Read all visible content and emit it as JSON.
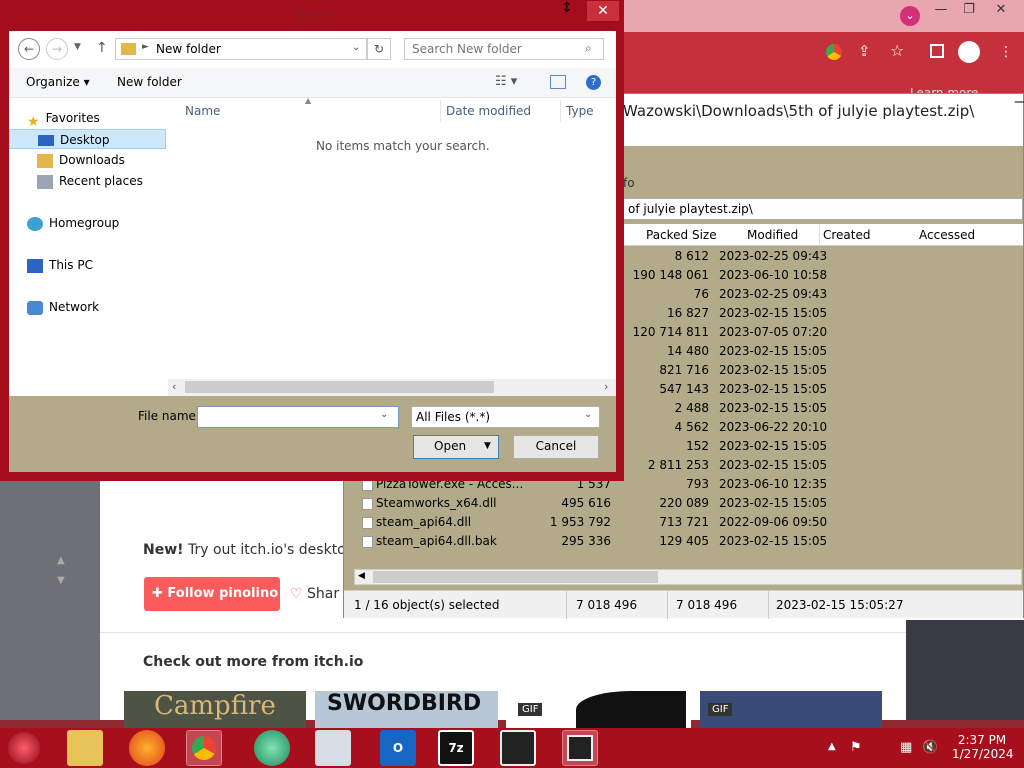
{
  "dialog": {
    "title": "Open",
    "close_glyph": "✕",
    "path_segment": "New folder",
    "search_placeholder": "Search New folder",
    "organize_label": "Organize ▾",
    "new_folder_label": "New folder",
    "columns": {
      "name": "Name",
      "date": "Date modified",
      "type": "Type"
    },
    "empty_message": "No items match your search.",
    "nav": {
      "favorites": "Favorites",
      "desktop": "Desktop",
      "downloads": "Downloads",
      "recent": "Recent places",
      "homegroup": "Homegroup",
      "thispc": "This PC",
      "network": "Network"
    },
    "filename_label": "File name:",
    "filename_value": "",
    "filetype_value": "All Files (*.*)",
    "open_label": "Open",
    "cancel_label": "Cancel"
  },
  "sevenzip": {
    "path_title": "Wazowski\\Downloads\\5th of julyie playtest.zip\\",
    "addr_path": "of julyie playtest.zip\\",
    "info_line": "fo",
    "columns": {
      "packed": "Packed Size",
      "modified": "Modified",
      "created": "Created",
      "accessed": "Accessed"
    },
    "rows": [
      {
        "name": "",
        "size": "",
        "packed": "8 612",
        "modified": "2023-02-25 09:43"
      },
      {
        "name": "",
        "size": "",
        "packed": "190 148 061",
        "modified": "2023-06-10 10:58"
      },
      {
        "name": "",
        "size": "",
        "packed": "76",
        "modified": "2023-02-25 09:43"
      },
      {
        "name": "",
        "size": "",
        "packed": "16 827",
        "modified": "2023-02-15 15:05"
      },
      {
        "name": "",
        "size": "",
        "packed": "120 714 811",
        "modified": "2023-07-05 07:20"
      },
      {
        "name": "",
        "size": "",
        "packed": "14 480",
        "modified": "2023-02-15 15:05"
      },
      {
        "name": "",
        "size": "",
        "packed": "821 716",
        "modified": "2023-02-15 15:05"
      },
      {
        "name": "",
        "size": "",
        "packed": "547 143",
        "modified": "2023-02-15 15:05"
      },
      {
        "name": "",
        "size": "",
        "packed": "2 488",
        "modified": "2023-02-15 15:05"
      },
      {
        "name": "",
        "size": "",
        "packed": "4 562",
        "modified": "2023-06-22 20:10"
      },
      {
        "name": "",
        "size": "",
        "packed": "152",
        "modified": "2023-02-15 15:05"
      },
      {
        "name": "",
        "size": "",
        "packed": "2 811 253",
        "modified": "2023-02-15 15:05"
      },
      {
        "name": "PizzaTower.exe - Acces...",
        "size": "1 537",
        "packed": "793",
        "modified": "2023-06-10 12:35"
      },
      {
        "name": "Steamworks_x64.dll",
        "size": "495 616",
        "packed": "220 089",
        "modified": "2023-02-15 15:05"
      },
      {
        "name": "steam_api64.dll",
        "size": "1 953 792",
        "packed": "713 721",
        "modified": "2022-09-06 09:50"
      },
      {
        "name": "steam_api64.dll.bak",
        "size": "295 336",
        "packed": "129 405",
        "modified": "2023-02-15 15:05"
      }
    ],
    "status": {
      "selected": "1 / 16 object(s) selected",
      "size": "7 018 496",
      "packed": "7 018 496",
      "modified": "2023-02-15 15:05:27"
    }
  },
  "itch": {
    "new_text_bold": "New!",
    "new_text": "Try out itch.io's deskto",
    "follow_label": "Follow pinolino",
    "share_label": "Shar",
    "more_heading": "Check out more from itch.io",
    "thumb_campfire": "Campfire",
    "thumb_swordbird": "SWORDBIRD",
    "gif_badge": "GIF",
    "learn_more": "Learn more"
  },
  "taskbar": {
    "time": "2:37 PM",
    "date": "1/27/2024",
    "app_7z": "7z"
  },
  "colors": {
    "taskbar": "#a80f1c",
    "dialog_frame": "#a40d1c",
    "khaki": "#b3aa8a",
    "itch_red": "#fa5c5c"
  }
}
